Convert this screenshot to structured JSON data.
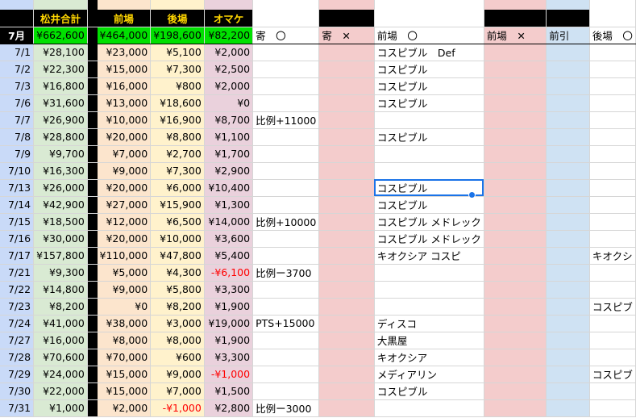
{
  "colors": {
    "date": "#c9daf8",
    "matsui": "#d9ead3",
    "zenba": "#fce5cd",
    "goba": "#fff2cc",
    "omake": "#ead1dc",
    "pink": "#f4cccc",
    "blue": "#cfe2f3",
    "header_total": "#00e000",
    "header_text": "#ffd600",
    "negative": "#ff0000"
  },
  "header": {
    "matsui_label": "松井合計",
    "zenba_label": "前場",
    "goba_label": "後場",
    "omake_label": "オマケ"
  },
  "totals": {
    "month": "7月",
    "matsui": "¥662,600",
    "zenba": "¥464,000",
    "goba": "¥198,600",
    "omake": "¥82,200",
    "yori_ok": "寄　〇",
    "yori_ng": "寄　✕",
    "zenba_ok": "前場　〇",
    "zenba_ng": "前場　✕",
    "maebiki": "前引",
    "goba_ok": "後場　〇"
  },
  "rows": [
    {
      "date": "7/1",
      "matsui": "¥28,100",
      "zenba": "¥23,000",
      "goba": "¥5,100",
      "omake": "¥2,000",
      "note": "",
      "zenba_ok": "コスピブル　Def",
      "goba_ok": ""
    },
    {
      "date": "7/2",
      "matsui": "¥22,300",
      "zenba": "¥15,000",
      "goba": "¥7,300",
      "omake": "¥2,500",
      "note": "",
      "zenba_ok": "コスピブル",
      "goba_ok": ""
    },
    {
      "date": "7/3",
      "matsui": "¥16,800",
      "zenba": "¥16,000",
      "goba": "¥800",
      "omake": "¥2,000",
      "note": "",
      "zenba_ok": "コスピブル",
      "goba_ok": ""
    },
    {
      "date": "7/6",
      "matsui": "¥31,600",
      "zenba": "¥13,000",
      "goba": "¥18,600",
      "omake": "¥0",
      "note": "",
      "zenba_ok": "コスピブル",
      "goba_ok": ""
    },
    {
      "date": "7/7",
      "matsui": "¥26,900",
      "zenba": "¥10,000",
      "goba": "¥16,900",
      "omake": "¥8,700",
      "note": "比例+11000",
      "zenba_ok": "",
      "goba_ok": ""
    },
    {
      "date": "7/8",
      "matsui": "¥28,800",
      "zenba": "¥20,000",
      "goba": "¥8,800",
      "omake": "¥1,100",
      "note": "",
      "zenba_ok": "コスピブル",
      "goba_ok": ""
    },
    {
      "date": "7/9",
      "matsui": "¥9,700",
      "zenba": "¥7,000",
      "goba": "¥2,700",
      "omake": "¥1,700",
      "note": "",
      "zenba_ok": "",
      "goba_ok": ""
    },
    {
      "date": "7/10",
      "matsui": "¥16,300",
      "zenba": "¥9,000",
      "goba": "¥7,300",
      "omake": "¥2,900",
      "note": "",
      "zenba_ok": "",
      "goba_ok": ""
    },
    {
      "date": "7/13",
      "matsui": "¥26,000",
      "zenba": "¥20,000",
      "goba": "¥6,000",
      "omake": "¥10,400",
      "note": "",
      "zenba_ok": "コスピブル",
      "goba_ok": ""
    },
    {
      "date": "7/14",
      "matsui": "¥42,900",
      "zenba": "¥27,000",
      "goba": "¥15,900",
      "omake": "¥1,300",
      "note": "",
      "zenba_ok": "コスピブル",
      "goba_ok": ""
    },
    {
      "date": "7/15",
      "matsui": "¥18,500",
      "zenba": "¥12,000",
      "goba": "¥6,500",
      "omake": "¥14,000",
      "note": "比例+10000",
      "zenba_ok": "コスピブル メドレック",
      "goba_ok": ""
    },
    {
      "date": "7/16",
      "matsui": "¥30,000",
      "zenba": "¥20,000",
      "goba": "¥10,000",
      "omake": "¥3,600",
      "note": "",
      "zenba_ok": "コスピブル メドレック",
      "goba_ok": ""
    },
    {
      "date": "7/17",
      "matsui": "¥157,800",
      "zenba": "¥110,000",
      "goba": "¥47,800",
      "omake": "¥5,400",
      "note": "",
      "zenba_ok": "キオクシア コスピ",
      "goba_ok": "キオクシ"
    },
    {
      "date": "7/21",
      "matsui": "¥9,300",
      "zenba": "¥5,000",
      "goba": "¥4,300",
      "omake": "-¥6,100",
      "note": "比例ー3700",
      "zenba_ok": "",
      "goba_ok": ""
    },
    {
      "date": "7/22",
      "matsui": "¥14,800",
      "zenba": "¥9,000",
      "goba": "¥5,800",
      "omake": "¥3,300",
      "note": "",
      "zenba_ok": "",
      "goba_ok": ""
    },
    {
      "date": "7/23",
      "matsui": "¥8,200",
      "zenba": "¥0",
      "goba": "¥8,200",
      "omake": "¥1,900",
      "note": "",
      "zenba_ok": "",
      "goba_ok": "コスピブ"
    },
    {
      "date": "7/24",
      "matsui": "¥41,000",
      "zenba": "¥38,000",
      "goba": "¥3,000",
      "omake": "¥19,000",
      "note": "PTS+15000",
      "zenba_ok": "ディスコ",
      "goba_ok": ""
    },
    {
      "date": "7/27",
      "matsui": "¥16,000",
      "zenba": "¥8,000",
      "goba": "¥8,000",
      "omake": "¥1,900",
      "note": "",
      "zenba_ok": "大黒屋",
      "goba_ok": ""
    },
    {
      "date": "7/28",
      "matsui": "¥70,600",
      "zenba": "¥70,000",
      "goba": "¥600",
      "omake": "¥3,300",
      "note": "",
      "zenba_ok": "キオクシア",
      "goba_ok": ""
    },
    {
      "date": "7/29",
      "matsui": "¥24,000",
      "zenba": "¥15,000",
      "goba": "¥9,000",
      "omake": "-¥1,000",
      "note": "",
      "zenba_ok": "メディアリン",
      "goba_ok": "コスピブ"
    },
    {
      "date": "7/30",
      "matsui": "¥22,000",
      "zenba": "¥15,000",
      "goba": "¥7,000",
      "omake": "¥1,500",
      "note": "",
      "zenba_ok": "コスピブル",
      "goba_ok": ""
    },
    {
      "date": "7/31",
      "matsui": "¥1,000",
      "zenba": "¥2,000",
      "goba": "-¥1,000",
      "omake": "¥2,800",
      "note": "比例ー3000",
      "zenba_ok": "",
      "goba_ok": ""
    }
  ],
  "selected_row_index": 8
}
